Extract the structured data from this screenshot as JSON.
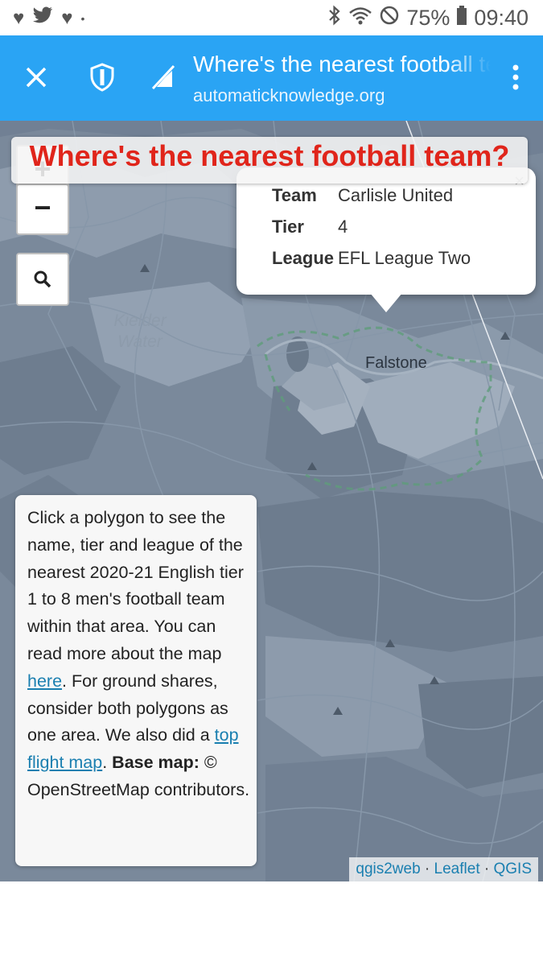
{
  "status_bar": {
    "left_icons": [
      "heart-icon",
      "twitter-icon",
      "heart-icon",
      "dot-icon"
    ],
    "battery": "75%",
    "time": "09:40"
  },
  "toolbar": {
    "page_title": "Where's the nearest football team?",
    "url": "automaticknowledge.org"
  },
  "map": {
    "title": "Where's the nearest football team?",
    "zoom_out_symbol": "−",
    "labels": {
      "lake_line1": "Kielder",
      "lake_line2": "Water",
      "town": "Falstone"
    },
    "popup": {
      "close_symbol": "×",
      "rows": [
        {
          "key": "Team",
          "value": "Carlisle United"
        },
        {
          "key": "Tier",
          "value": "4"
        },
        {
          "key": "League",
          "value": "EFL League Two"
        }
      ]
    },
    "info": {
      "text1": "Click a polygon to see the name, tier and league of the nearest 2020-21 English tier 1 to 8 men's football team within that area. You can read more about the map ",
      "link1": "here",
      "text2": ". For ground shares, consider both polygons as one area. We also did a ",
      "link2": "top flight map",
      "text3": ". ",
      "bold": "Base map:",
      "text4": " © OpenStreetMap contributors."
    },
    "attribution": {
      "qgis2web": "qgis2web",
      "sep1": " · ",
      "leaflet": "Leaflet",
      "sep2": " · ",
      "qgis": "QGIS"
    }
  }
}
